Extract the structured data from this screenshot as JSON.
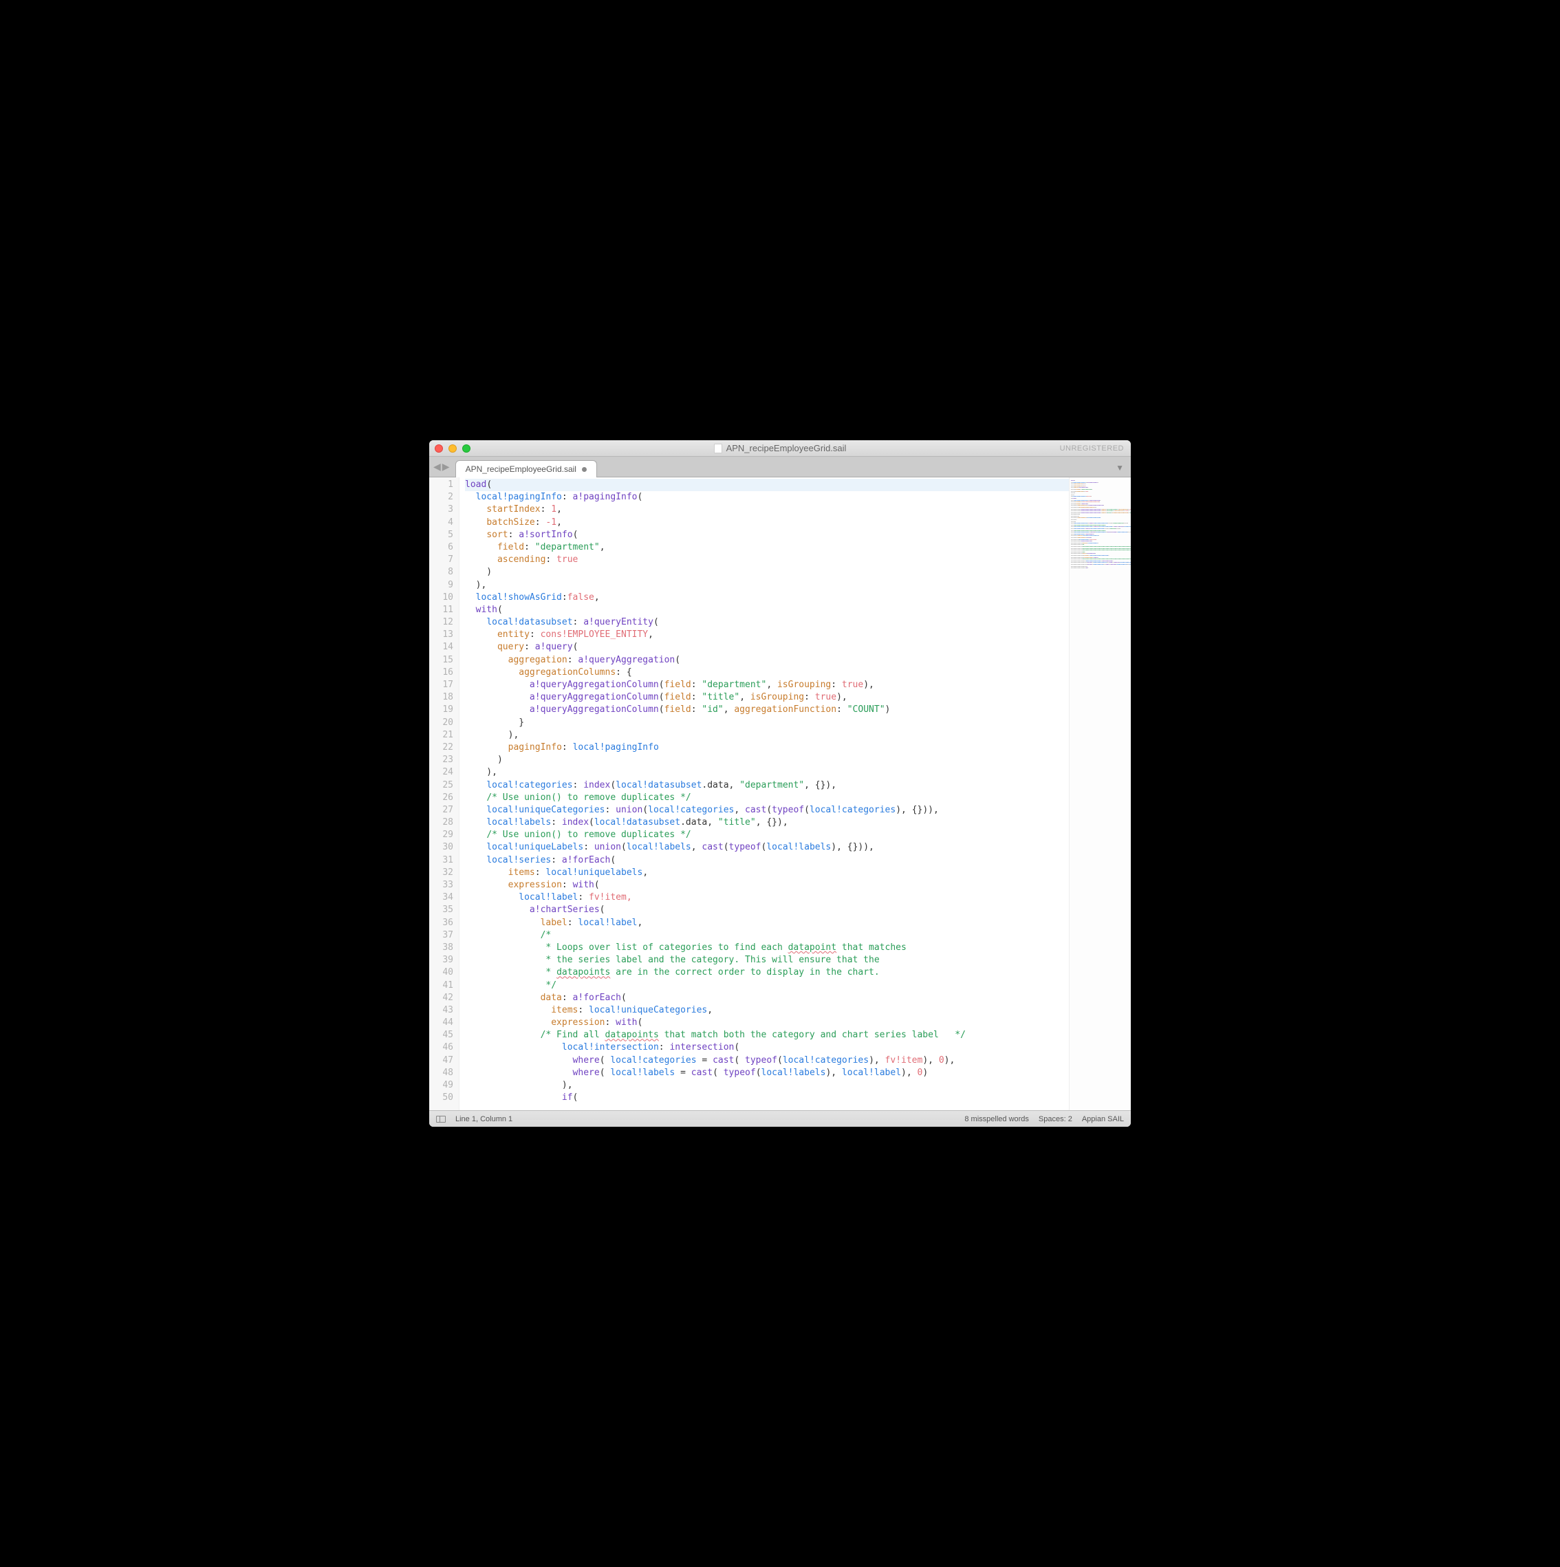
{
  "window": {
    "title": "APN_recipeEmployeeGrid.sail",
    "unregistered_label": "UNREGISTERED"
  },
  "tabs": {
    "active": {
      "label": "APN_recipeEmployeeGrid.sail",
      "dirty": true
    }
  },
  "statusbar": {
    "position": "Line 1, Column 1",
    "spell": "8 misspelled words",
    "spaces": "Spaces: 2",
    "syntax": "Appian SAIL"
  },
  "code": {
    "lines": [
      [
        [
          "k-purple",
          "load"
        ],
        [
          "",
          "("
        ]
      ],
      [
        [
          "",
          "  "
        ],
        [
          "k-blue",
          "local!pagingInfo"
        ],
        [
          "",
          ": "
        ],
        [
          "k-purple",
          "a!pagingInfo"
        ],
        [
          "",
          "("
        ]
      ],
      [
        [
          "",
          "    "
        ],
        [
          "k-orange",
          "startIndex"
        ],
        [
          "",
          ": "
        ],
        [
          "k-num",
          "1"
        ],
        [
          "",
          ","
        ]
      ],
      [
        [
          "",
          "    "
        ],
        [
          "k-orange",
          "batchSize"
        ],
        [
          "",
          ": "
        ],
        [
          "k-num",
          "-1"
        ],
        [
          "",
          ","
        ]
      ],
      [
        [
          "",
          "    "
        ],
        [
          "k-orange",
          "sort"
        ],
        [
          "",
          ": "
        ],
        [
          "k-purple",
          "a!sortInfo"
        ],
        [
          "",
          "("
        ]
      ],
      [
        [
          "",
          "      "
        ],
        [
          "k-orange",
          "field"
        ],
        [
          "",
          ": "
        ],
        [
          "k-str",
          "\"department\""
        ],
        [
          "",
          ","
        ]
      ],
      [
        [
          "",
          "      "
        ],
        [
          "k-orange",
          "ascending"
        ],
        [
          "",
          ": "
        ],
        [
          "k-const",
          "true"
        ]
      ],
      [
        [
          "",
          "    )"
        ]
      ],
      [
        [
          "",
          "  ),"
        ]
      ],
      [
        [
          "",
          "  "
        ],
        [
          "k-blue",
          "local!showAsGrid"
        ],
        [
          "",
          ":"
        ],
        [
          "k-const",
          "false"
        ],
        [
          "",
          ","
        ]
      ],
      [
        [
          "",
          "  "
        ],
        [
          "k-purple",
          "with"
        ],
        [
          "",
          "("
        ]
      ],
      [
        [
          "",
          "    "
        ],
        [
          "k-blue",
          "local!datasubset"
        ],
        [
          "",
          ": "
        ],
        [
          "k-purple",
          "a!queryEntity"
        ],
        [
          "",
          "("
        ]
      ],
      [
        [
          "",
          "      "
        ],
        [
          "k-orange",
          "entity"
        ],
        [
          "",
          ": "
        ],
        [
          "k-const",
          "cons!EMPLOYEE_ENTITY"
        ],
        [
          "",
          ","
        ]
      ],
      [
        [
          "",
          "      "
        ],
        [
          "k-orange",
          "query"
        ],
        [
          "",
          ": "
        ],
        [
          "k-purple",
          "a!query"
        ],
        [
          "",
          "("
        ]
      ],
      [
        [
          "",
          "        "
        ],
        [
          "k-orange",
          "aggregation"
        ],
        [
          "",
          ": "
        ],
        [
          "k-purple",
          "a!queryAggregation"
        ],
        [
          "",
          "("
        ]
      ],
      [
        [
          "",
          "          "
        ],
        [
          "k-orange",
          "aggregationColumns"
        ],
        [
          "",
          ": {"
        ]
      ],
      [
        [
          "",
          "            "
        ],
        [
          "k-purple",
          "a!queryAggregationColumn"
        ],
        [
          "",
          "("
        ],
        [
          "k-orange",
          "field"
        ],
        [
          "",
          ": "
        ],
        [
          "k-str",
          "\"department\""
        ],
        [
          "",
          ", "
        ],
        [
          "k-orange",
          "isGrouping"
        ],
        [
          "",
          ": "
        ],
        [
          "k-const",
          "true"
        ],
        [
          "",
          "),"
        ]
      ],
      [
        [
          "",
          "            "
        ],
        [
          "k-purple",
          "a!queryAggregationColumn"
        ],
        [
          "",
          "("
        ],
        [
          "k-orange",
          "field"
        ],
        [
          "",
          ": "
        ],
        [
          "k-str",
          "\"title\""
        ],
        [
          "",
          ", "
        ],
        [
          "k-orange",
          "isGrouping"
        ],
        [
          "",
          ": "
        ],
        [
          "k-const",
          "true"
        ],
        [
          "",
          "),"
        ]
      ],
      [
        [
          "",
          "            "
        ],
        [
          "k-purple",
          "a!queryAggregationColumn"
        ],
        [
          "",
          "("
        ],
        [
          "k-orange",
          "field"
        ],
        [
          "",
          ": "
        ],
        [
          "k-str",
          "\"id\""
        ],
        [
          "",
          ", "
        ],
        [
          "k-orange",
          "aggregationFunction"
        ],
        [
          "",
          ": "
        ],
        [
          "k-str",
          "\"COUNT\""
        ],
        [
          "",
          ")"
        ]
      ],
      [
        [
          "",
          "          }"
        ]
      ],
      [
        [
          "",
          "        ),"
        ]
      ],
      [
        [
          "",
          "        "
        ],
        [
          "k-orange",
          "pagingInfo"
        ],
        [
          "",
          ": "
        ],
        [
          "k-blue",
          "local!pagingInfo"
        ]
      ],
      [
        [
          "",
          "      )"
        ]
      ],
      [
        [
          "",
          "    ),"
        ]
      ],
      [
        [
          "",
          "    "
        ],
        [
          "k-blue",
          "local!categories"
        ],
        [
          "",
          ": "
        ],
        [
          "k-purple",
          "index"
        ],
        [
          "",
          "("
        ],
        [
          "k-blue",
          "local!datasubset"
        ],
        [
          "",
          ".data, "
        ],
        [
          "k-str",
          "\"department\""
        ],
        [
          "",
          ", {}),"
        ]
      ],
      [
        [
          "",
          "    "
        ],
        [
          "k-comment",
          "/* Use union() to remove duplicates */"
        ]
      ],
      [
        [
          "",
          "    "
        ],
        [
          "k-blue",
          "local!uniqueCategories"
        ],
        [
          "",
          ": "
        ],
        [
          "k-purple",
          "union"
        ],
        [
          "",
          "("
        ],
        [
          "k-blue",
          "local!categories"
        ],
        [
          "",
          ", "
        ],
        [
          "k-purple",
          "cast"
        ],
        [
          "",
          "("
        ],
        [
          "k-purple",
          "typeof"
        ],
        [
          "",
          "("
        ],
        [
          "k-blue",
          "local!categories"
        ],
        [
          "",
          ")"
        ],
        [
          "",
          ", {})),"
        ]
      ],
      [
        [
          "",
          "    "
        ],
        [
          "k-blue",
          "local!labels"
        ],
        [
          "",
          ": "
        ],
        [
          "k-purple",
          "index"
        ],
        [
          "",
          "("
        ],
        [
          "k-blue",
          "local!datasubset"
        ],
        [
          "",
          ".data, "
        ],
        [
          "k-str",
          "\"title\""
        ],
        [
          "",
          ", {}),"
        ]
      ],
      [
        [
          "",
          "    "
        ],
        [
          "k-comment",
          "/* Use union() to remove duplicates */"
        ]
      ],
      [
        [
          "",
          "    "
        ],
        [
          "k-blue",
          "local!uniqueLabels"
        ],
        [
          "",
          ": "
        ],
        [
          "k-purple",
          "union"
        ],
        [
          "",
          "("
        ],
        [
          "k-blue",
          "local!labels"
        ],
        [
          "",
          ", "
        ],
        [
          "k-purple",
          "cast"
        ],
        [
          "",
          "("
        ],
        [
          "k-purple",
          "typeof"
        ],
        [
          "",
          "("
        ],
        [
          "k-blue",
          "local!labels"
        ],
        [
          "",
          "), {})),"
        ]
      ],
      [
        [
          "",
          "    "
        ],
        [
          "k-blue",
          "local!series"
        ],
        [
          "",
          ": "
        ],
        [
          "k-purple",
          "a!forEach"
        ],
        [
          "",
          "("
        ]
      ],
      [
        [
          "",
          "        "
        ],
        [
          "k-orange",
          "items"
        ],
        [
          "",
          ": "
        ],
        [
          "k-blue",
          "local!uniquelabels"
        ],
        [
          "",
          ","
        ]
      ],
      [
        [
          "",
          "        "
        ],
        [
          "k-orange",
          "expression"
        ],
        [
          "",
          ": "
        ],
        [
          "k-purple",
          "with"
        ],
        [
          "",
          "("
        ]
      ],
      [
        [
          "",
          "          "
        ],
        [
          "k-blue",
          "local!label"
        ],
        [
          "",
          ": "
        ],
        [
          "k-const",
          "fv!item,"
        ]
      ],
      [
        [
          "",
          "            "
        ],
        [
          "k-purple",
          "a!chartSeries"
        ],
        [
          "",
          "("
        ]
      ],
      [
        [
          "",
          "              "
        ],
        [
          "k-orange",
          "label"
        ],
        [
          "",
          ": "
        ],
        [
          "k-blue",
          "local!label"
        ],
        [
          "",
          ","
        ]
      ],
      [
        [
          "",
          "              "
        ],
        [
          "k-comment",
          "/*"
        ]
      ],
      [
        [
          "",
          "              "
        ],
        [
          "k-comment",
          " * Loops over list of categories to find each "
        ],
        [
          "k-comment k-err",
          "datapoint"
        ],
        [
          "k-comment",
          " that matches"
        ]
      ],
      [
        [
          "",
          "              "
        ],
        [
          "k-comment",
          " * the series label and the category. This will ensure that the"
        ]
      ],
      [
        [
          "",
          "              "
        ],
        [
          "k-comment",
          " * "
        ],
        [
          "k-comment k-err",
          "datapoints"
        ],
        [
          "k-comment",
          " are in the correct order to display in the chart."
        ]
      ],
      [
        [
          "",
          "              "
        ],
        [
          "k-comment",
          " */"
        ]
      ],
      [
        [
          "",
          "              "
        ],
        [
          "k-orange",
          "data"
        ],
        [
          "",
          ": "
        ],
        [
          "k-purple",
          "a!forEach"
        ],
        [
          "",
          "("
        ]
      ],
      [
        [
          "",
          "                "
        ],
        [
          "k-orange",
          "items"
        ],
        [
          "",
          ": "
        ],
        [
          "k-blue",
          "local!uniqueCategories"
        ],
        [
          "",
          ","
        ]
      ],
      [
        [
          "",
          "                "
        ],
        [
          "k-orange",
          "expression"
        ],
        [
          "",
          ": "
        ],
        [
          "k-purple",
          "with"
        ],
        [
          "",
          "("
        ]
      ],
      [
        [
          "",
          "              "
        ],
        [
          "k-comment",
          "/* Find all "
        ],
        [
          "k-comment k-err",
          "datapoints"
        ],
        [
          "k-comment",
          " that match both the category and chart series label   */"
        ]
      ],
      [
        [
          "",
          "                  "
        ],
        [
          "k-blue",
          "local!intersection"
        ],
        [
          "",
          ": "
        ],
        [
          "k-purple",
          "intersection"
        ],
        [
          "",
          "("
        ]
      ],
      [
        [
          "",
          "                    "
        ],
        [
          "k-purple",
          "where"
        ],
        [
          "",
          "( "
        ],
        [
          "k-blue",
          "local!categories"
        ],
        [
          "",
          " = "
        ],
        [
          "k-purple",
          "cast"
        ],
        [
          "",
          "( "
        ],
        [
          "k-purple",
          "typeof"
        ],
        [
          "",
          "("
        ],
        [
          "k-blue",
          "local!categories"
        ],
        [
          "",
          "), "
        ],
        [
          "k-const",
          "fv!item"
        ],
        [
          "",
          "), "
        ],
        [
          "k-num",
          "0"
        ],
        [
          "",
          "),"
        ]
      ],
      [
        [
          "",
          "                    "
        ],
        [
          "k-purple",
          "where"
        ],
        [
          "",
          "( "
        ],
        [
          "k-blue",
          "local!labels"
        ],
        [
          "",
          " = "
        ],
        [
          "k-purple",
          "cast"
        ],
        [
          "",
          "( "
        ],
        [
          "k-purple",
          "typeof"
        ],
        [
          "",
          "("
        ],
        [
          "k-blue",
          "local!labels"
        ],
        [
          "",
          "), "
        ],
        [
          "k-blue",
          "local!label"
        ],
        [
          "",
          "), "
        ],
        [
          "k-num",
          "0"
        ],
        [
          "",
          ")"
        ]
      ],
      [
        [
          "",
          "                  ),"
        ]
      ],
      [
        [
          "",
          "                  "
        ],
        [
          "k-purple",
          "if"
        ],
        [
          "",
          "("
        ]
      ]
    ]
  }
}
